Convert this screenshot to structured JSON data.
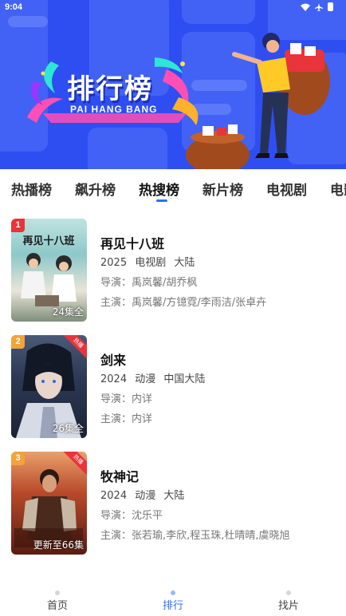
{
  "status": {
    "time": "9:04"
  },
  "banner": {
    "title": "排行榜",
    "subtitle": "PAI HANG BANG"
  },
  "tabs": [
    {
      "label": "热播榜"
    },
    {
      "label": "飙升榜"
    },
    {
      "label": "热搜榜",
      "active": true
    },
    {
      "label": "新片榜"
    },
    {
      "label": "电视剧"
    },
    {
      "label": "电影"
    }
  ],
  "items": [
    {
      "rank": "1",
      "rank_color": "#e8343a",
      "poster_title": "再见十八班",
      "episodes": "24集全",
      "title": "再见十八班",
      "year": "2025",
      "type": "电视剧",
      "region": "大陆",
      "director": "导演：禹岚馨/胡乔枫",
      "cast": "主演：禹岚馨/方镱霓/李雨洁/张卓卉"
    },
    {
      "rank": "2",
      "rank_color": "#f2a33a",
      "hot": "热播",
      "episodes": "26集全",
      "title": "剑来",
      "year": "2024",
      "type": "动漫",
      "region": "中国大陆",
      "director": "导演：内详",
      "cast": "主演：内详"
    },
    {
      "rank": "3",
      "rank_color": "#f2a33a",
      "hot": "热播",
      "episodes": "更新至66集",
      "title": "牧神记",
      "year": "2024",
      "type": "动漫",
      "region": "大陆",
      "director": "导演：沈乐平",
      "cast": "主演：张若瑜,李欣,程玉珠,杜晴晴,虞晓旭"
    }
  ],
  "nav": [
    {
      "label": "首页"
    },
    {
      "label": "排行",
      "active": true
    },
    {
      "label": "找片"
    }
  ],
  "colors": {
    "banner": "#2f4ef2",
    "accent": "#2f6ef5",
    "rank1": "#e8343a",
    "rank_other": "#f2a33a"
  }
}
